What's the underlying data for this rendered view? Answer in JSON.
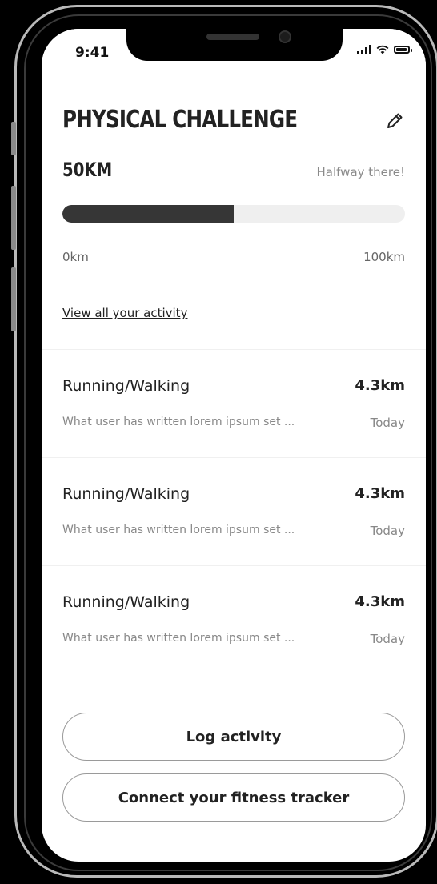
{
  "status_bar": {
    "time": "9:41"
  },
  "challenge": {
    "title": "PHYSICAL CHALLENGE",
    "goal": "50KM",
    "progress_text": "Halfway there!",
    "progress_fraction": 0.5,
    "range_min": "0km",
    "range_max": "100km",
    "view_all_link": "View all your activity"
  },
  "activities": [
    {
      "type": "Running/Walking",
      "distance": "4.3km",
      "description": "What user has written lorem ipsum set ...",
      "date": "Today"
    },
    {
      "type": "Running/Walking",
      "distance": "4.3km",
      "description": "What user has written lorem ipsum set ...",
      "date": "Today"
    },
    {
      "type": "Running/Walking",
      "distance": "4.3km",
      "description": "What user has written lorem ipsum set ...",
      "date": "Today"
    }
  ],
  "actions": {
    "log_activity": "Log activity",
    "connect_tracker": "Connect your fitness tracker"
  },
  "colors": {
    "progress_fill": "#363636",
    "progress_track": "#efefef"
  }
}
